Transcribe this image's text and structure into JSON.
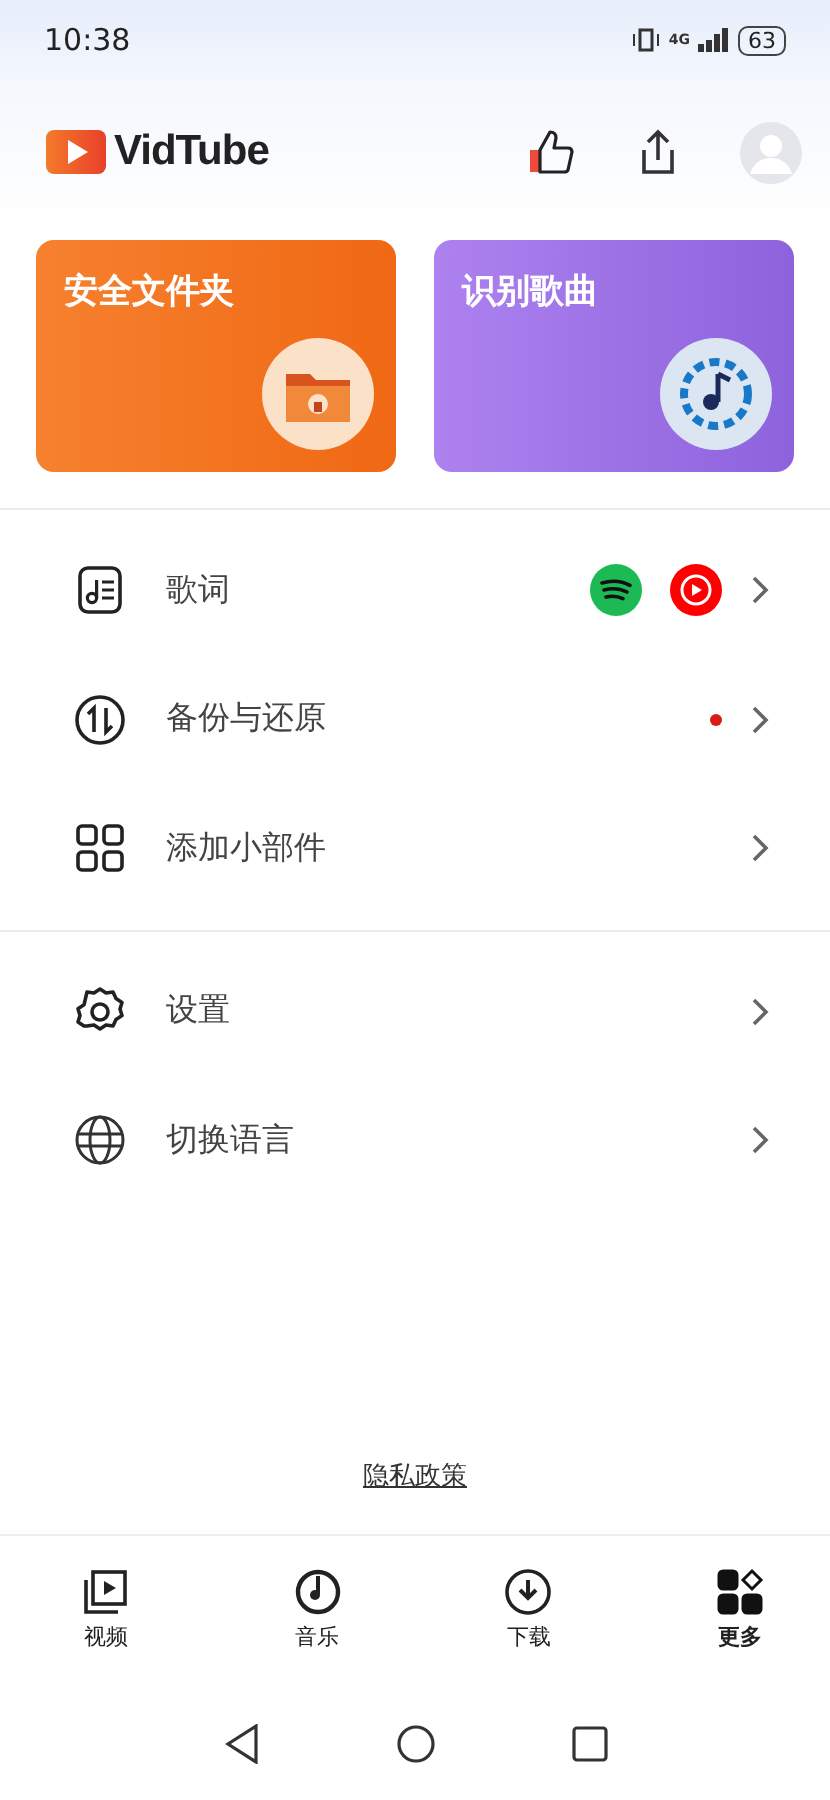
{
  "status_bar": {
    "time": "10:38",
    "network": "4G",
    "battery": "63"
  },
  "header": {
    "app_name": "VidTube"
  },
  "cards": [
    {
      "title": "安全文件夹",
      "kind": "folder"
    },
    {
      "title": "识别歌曲",
      "kind": "music"
    }
  ],
  "menu_groups": [
    [
      {
        "label": "歌词",
        "kind": "lyrics",
        "new_dot": false
      },
      {
        "label": "备份与还原",
        "kind": "backup",
        "new_dot": true
      },
      {
        "label": "添加小部件",
        "kind": "widgets",
        "new_dot": false
      }
    ],
    [
      {
        "label": "设置",
        "kind": "settings",
        "new_dot": false
      },
      {
        "label": "切换语言",
        "kind": "language",
        "new_dot": false
      }
    ]
  ],
  "privacy_link": "隐私政策",
  "bottom_nav": [
    {
      "label": "视频",
      "kind": "video",
      "selected": false
    },
    {
      "label": "音乐",
      "kind": "music",
      "selected": false
    },
    {
      "label": "下载",
      "kind": "download",
      "selected": false
    },
    {
      "label": "更多",
      "kind": "more",
      "selected": true
    }
  ]
}
